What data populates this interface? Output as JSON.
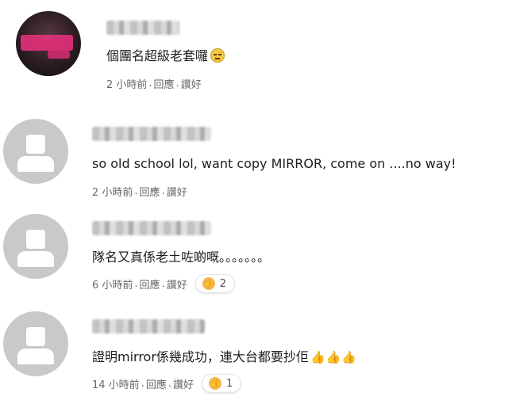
{
  "comments": [
    {
      "text": "個團名超級老套囉",
      "emoji": "expressionless-face-icon",
      "time": "2 小時前",
      "reply": "回應",
      "like": "讚好",
      "reactions": null
    },
    {
      "text": "so old school lol, want copy MIRROR, come on ....no way!",
      "time": "2 小時前",
      "reply": "回應",
      "like": "讚好",
      "reactions": null
    },
    {
      "text": "隊名又真係老土咗啲嘅。。。。。。。",
      "time": "6 小時前",
      "reply": "回應",
      "like": "讚好",
      "reactions": "2"
    },
    {
      "text": "證明mirror係幾成功，連大台都要抄佢",
      "emoji_trail": "👍👍👍",
      "time": "14 小時前",
      "reply": "回應",
      "like": "讚好",
      "reactions": "1"
    }
  ],
  "separator": ".",
  "colors": {
    "meta": "#65676b",
    "text": "#1c1e21",
    "avatar_default": "#c9c9c9"
  }
}
